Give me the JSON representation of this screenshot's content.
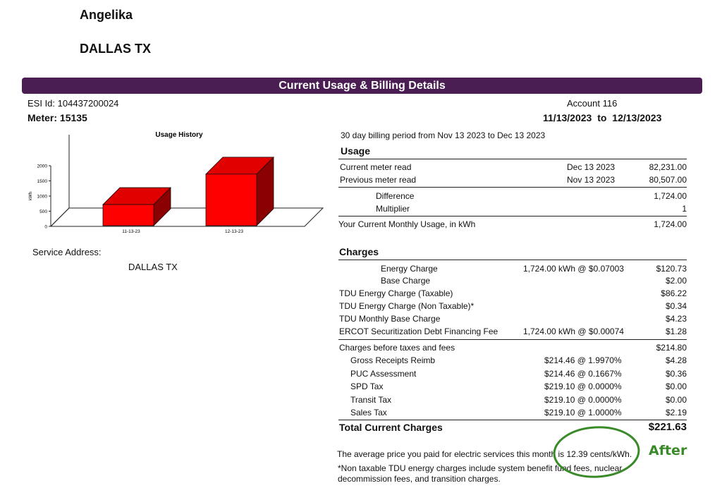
{
  "customer": {
    "name": "Angelika",
    "city_state": "DALLAS TX"
  },
  "banner_title": "Current Usage & Billing Details",
  "esi_label": "ESI Id:",
  "esi_id": "104437200024",
  "meter_label": "Meter:",
  "meter": "15135",
  "account": "Account 116",
  "period": {
    "from": "11/13/2023",
    "to_word": "to",
    "to": "12/13/2023"
  },
  "billing_period_text": "30 day billing period from Nov 13 2023 to Dec 13 2023",
  "chart_data": {
    "type": "bar",
    "title": "Usage History",
    "ylabel": "kWh",
    "categories": [
      "11-13-23",
      "12-13-23"
    ],
    "values": [
      720,
      1724
    ],
    "ylim": [
      0,
      2000
    ],
    "yticks": [
      "0",
      "500",
      "1000",
      "1500",
      "2000"
    ],
    "colors": {
      "front": "#ff0000",
      "top": "#e00000",
      "side": "#8b0000"
    }
  },
  "service_address_label": "Service Address:",
  "service_address": "DALLAS TX",
  "usage": {
    "title": "Usage",
    "current_read": {
      "label": "Current meter read",
      "date": "Dec 13 2023",
      "value": "82,231.00"
    },
    "previous_read": {
      "label": "Previous meter read",
      "date": "Nov 13 2023",
      "value": "80,507.00"
    },
    "difference": {
      "label": "Difference",
      "value": "1,724.00"
    },
    "multiplier": {
      "label": "Multiplier",
      "value": "1"
    },
    "monthly": {
      "label": "Your Current Monthly Usage, in kWh",
      "value": "1,724.00"
    }
  },
  "charges": {
    "title": "Charges",
    "energy_charge": {
      "label": "Energy Charge",
      "detail": "1,724.00 kWh @ $0.07003",
      "amount": "$120.73"
    },
    "base_charge": {
      "label": "Base Charge",
      "amount": "$2.00"
    },
    "tdu_taxable": {
      "label": "TDU Energy Charge (Taxable)",
      "amount": "$86.22"
    },
    "tdu_nontaxable": {
      "label": "TDU Energy Charge (Non Taxable)*",
      "amount": "$0.34"
    },
    "tdu_base": {
      "label": "TDU Monthly Base Charge",
      "amount": "$4.23"
    },
    "ercot": {
      "label": "ERCOT Securitization Debt Financing Fee",
      "detail": "1,724.00 kWh @ $0.00074",
      "amount": "$1.28"
    },
    "before_taxes": {
      "label": "Charges before taxes and fees",
      "amount": "$214.80"
    },
    "gross_receipts": {
      "label": "Gross Receipts Reimb",
      "detail": "$214.46 @ 1.9970%",
      "amount": "$4.28"
    },
    "puc": {
      "label": "PUC Assessment",
      "detail": "$214.46 @ 0.1667%",
      "amount": "$0.36"
    },
    "spd": {
      "label": "SPD Tax",
      "detail": "$219.10 @ 0.0000%",
      "amount": "$0.00"
    },
    "transit": {
      "label": "Transit Tax",
      "detail": "$219.10 @ 0.0000%",
      "amount": "$0.00"
    },
    "sales": {
      "label": "Sales Tax",
      "detail": "$219.10 @ 1.0000%",
      "amount": "$2.19"
    },
    "total": {
      "label": "Total Current Charges",
      "amount": "$221.63"
    }
  },
  "footnote_avg": "The average price you paid for electric services this month is 12.39 cents/kWh.",
  "footnote_nontax_1": "*Non taxable TDU energy charges include system benefit fund fees, nuclear",
  "footnote_nontax_2": "decommission fees, and transition charges.",
  "annotation": {
    "label": "After",
    "color": "#3a8a2a"
  }
}
